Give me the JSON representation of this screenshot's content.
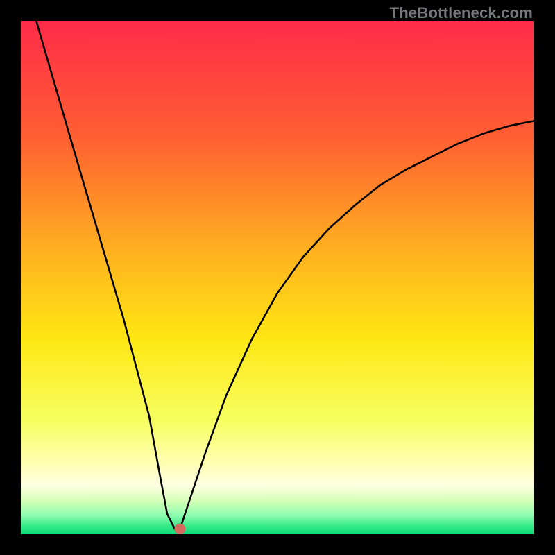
{
  "watermark": "TheBottleneck.com",
  "chart_data": {
    "type": "line",
    "title": "",
    "xlabel": "",
    "ylabel": "",
    "xlim": [
      0,
      100
    ],
    "ylim": [
      0,
      100
    ],
    "grid": false,
    "legend": false,
    "series": [
      {
        "name": "curve",
        "x": [
          3,
          10,
          15,
          20,
          25,
          27,
          28.5,
          30,
          31,
          32,
          34,
          36,
          40,
          45,
          50,
          55,
          60,
          65,
          70,
          75,
          80,
          85,
          90,
          95,
          100
        ],
        "y": [
          100,
          76,
          59,
          42,
          23,
          12,
          4,
          1,
          1,
          4,
          10,
          16,
          27,
          38,
          47,
          54,
          59.5,
          64,
          68,
          71,
          73.5,
          76,
          78,
          79.5,
          80.5
        ]
      }
    ],
    "marker": {
      "x": 31,
      "y": 1,
      "color": "#d56a5f",
      "radius_px": 8
    },
    "background_gradient": {
      "stops": [
        {
          "offset": 0.0,
          "color": "#ff2b49"
        },
        {
          "offset": 0.22,
          "color": "#ff5d33"
        },
        {
          "offset": 0.45,
          "color": "#ffb11f"
        },
        {
          "offset": 0.62,
          "color": "#ffe713"
        },
        {
          "offset": 0.78,
          "color": "#f6ff61"
        },
        {
          "offset": 0.86,
          "color": "#ffffb0"
        },
        {
          "offset": 0.905,
          "color": "#fdffe1"
        },
        {
          "offset": 0.935,
          "color": "#d6ffb8"
        },
        {
          "offset": 0.965,
          "color": "#86fcae"
        },
        {
          "offset": 0.985,
          "color": "#31e987"
        },
        {
          "offset": 1.0,
          "color": "#11d877"
        }
      ]
    }
  }
}
